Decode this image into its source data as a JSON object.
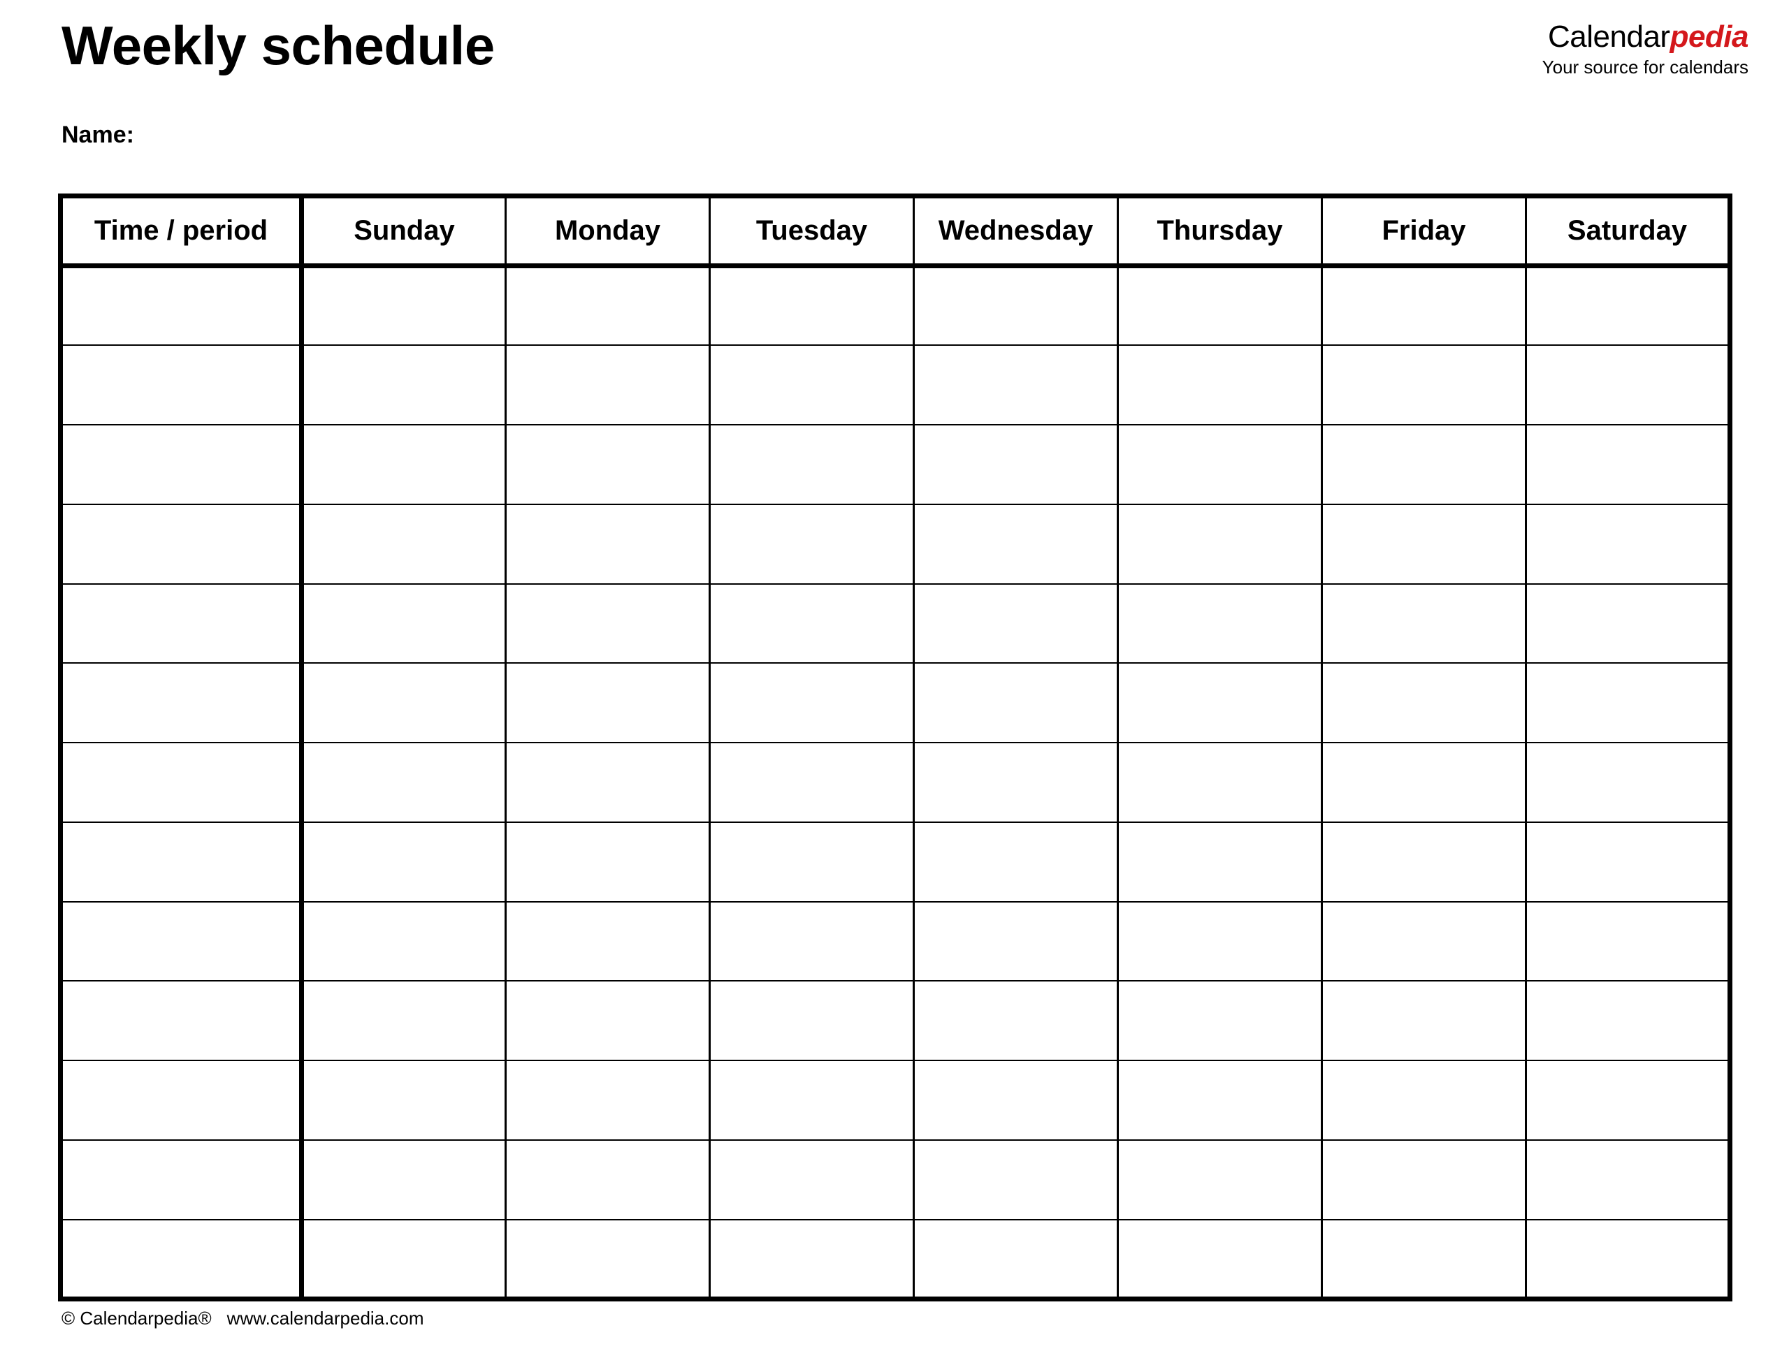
{
  "document": {
    "title": "Weekly schedule",
    "name_label": "Name:"
  },
  "brand": {
    "name_part1": "Calendar",
    "name_part2": "pedia",
    "tagline": "Your source for calendars",
    "accent_color": "#d4181c",
    "text_color": "#000000"
  },
  "table": {
    "columns": [
      "Time / period",
      "Sunday",
      "Monday",
      "Tuesday",
      "Wednesday",
      "Thursday",
      "Friday",
      "Saturday"
    ],
    "row_count": 13,
    "rows": [
      [
        "",
        "",
        "",
        "",
        "",
        "",
        "",
        ""
      ],
      [
        "",
        "",
        "",
        "",
        "",
        "",
        "",
        ""
      ],
      [
        "",
        "",
        "",
        "",
        "",
        "",
        "",
        ""
      ],
      [
        "",
        "",
        "",
        "",
        "",
        "",
        "",
        ""
      ],
      [
        "",
        "",
        "",
        "",
        "",
        "",
        "",
        ""
      ],
      [
        "",
        "",
        "",
        "",
        "",
        "",
        "",
        ""
      ],
      [
        "",
        "",
        "",
        "",
        "",
        "",
        "",
        ""
      ],
      [
        "",
        "",
        "",
        "",
        "",
        "",
        "",
        ""
      ],
      [
        "",
        "",
        "",
        "",
        "",
        "",
        "",
        ""
      ],
      [
        "",
        "",
        "",
        "",
        "",
        "",
        "",
        ""
      ],
      [
        "",
        "",
        "",
        "",
        "",
        "",
        "",
        ""
      ],
      [
        "",
        "",
        "",
        "",
        "",
        "",
        "",
        ""
      ],
      [
        "",
        "",
        "",
        "",
        "",
        "",
        "",
        ""
      ]
    ]
  },
  "footer": {
    "copyright": "© Calendarpedia®",
    "website": "www.calendarpedia.com"
  }
}
